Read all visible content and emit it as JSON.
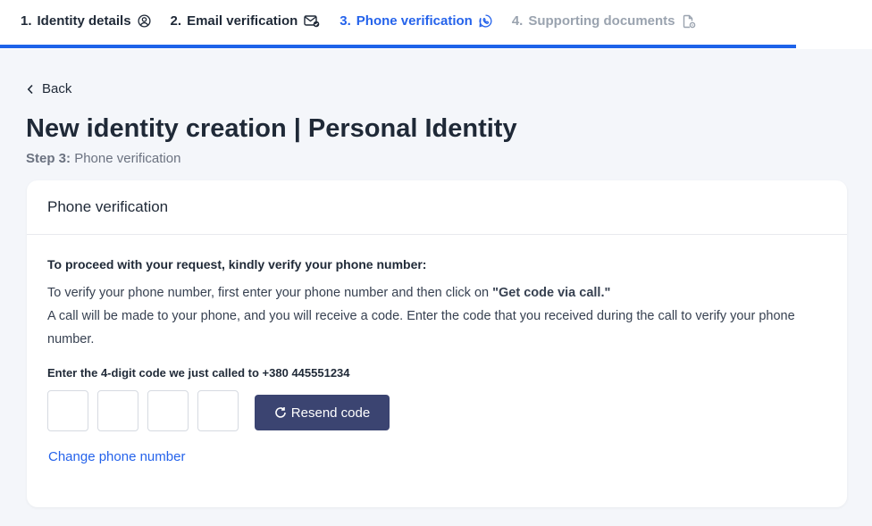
{
  "stepper": {
    "steps": [
      {
        "num": "1.",
        "label": "Identity details",
        "state": "done",
        "icon": "user-circle-icon"
      },
      {
        "num": "2.",
        "label": "Email verification",
        "state": "done",
        "icon": "mail-check-icon"
      },
      {
        "num": "3.",
        "label": "Phone verification",
        "state": "active",
        "icon": "phone-circle-icon"
      },
      {
        "num": "4.",
        "label": "Supporting documents",
        "state": "disabled",
        "icon": "document-settings-icon"
      }
    ],
    "progress": 1.0,
    "active_color": "#2563eb"
  },
  "nav": {
    "back_label": "Back"
  },
  "page": {
    "title": "New identity creation | Personal Identity",
    "step_prefix": "Step 3:",
    "step_name": "Phone verification"
  },
  "card": {
    "header": "Phone verification",
    "instruction": "To proceed with your request, kindly verify your phone number:",
    "desc_line1_pre": "To verify your phone number, first enter your phone number and then click on ",
    "desc_line1_bold": "\"Get code via call.\"",
    "desc_line2": "A call will be made to your phone, and you will receive a code. Enter the code that you received during the call to verify your phone number.",
    "code_label_pre": "Enter the 4-digit code we just called to ",
    "code_label_phone": "+380 445551234",
    "code_digits": [
      "",
      "",
      "",
      ""
    ],
    "resend_label": "Resend code",
    "resend_color": "#3b4471",
    "change_phone_label": "Change phone number"
  }
}
